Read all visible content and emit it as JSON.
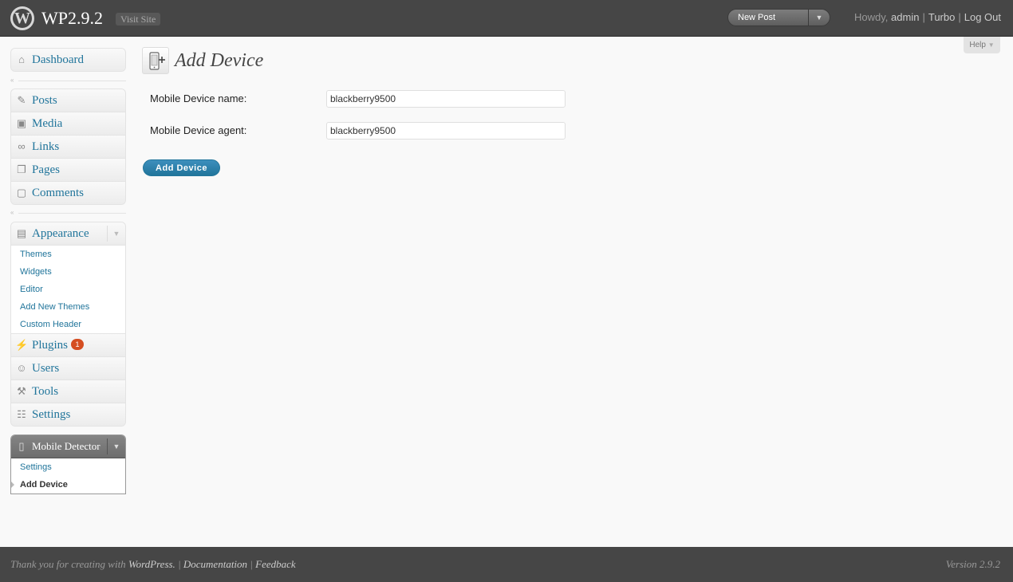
{
  "header": {
    "site_title": "WP2.9.2",
    "visit_site": "Visit Site",
    "favorite_action": "New Post",
    "howdy": "Howdy,",
    "user_name": "admin",
    "turbo": "Turbo",
    "log_out": "Log Out",
    "separator": "|"
  },
  "help": {
    "label": "Help"
  },
  "menu": {
    "dashboard": "Dashboard",
    "posts": "Posts",
    "media": "Media",
    "links": "Links",
    "pages": "Pages",
    "comments": "Comments",
    "appearance": "Appearance",
    "appearance_sub": [
      "Themes",
      "Widgets",
      "Editor",
      "Add New Themes",
      "Custom Header"
    ],
    "plugins": "Plugins",
    "plugins_badge": "1",
    "users": "Users",
    "tools": "Tools",
    "settings": "Settings",
    "mobile_detector": "Mobile Detector",
    "mobile_sub": [
      "Settings",
      "Add Device"
    ]
  },
  "page": {
    "title": "Add Device",
    "device_name_label": "Mobile Device name:",
    "device_name_value": "blackberry9500",
    "device_agent_label": "Mobile Device agent:",
    "device_agent_value": "blackberry9500",
    "submit_label": "Add Device"
  },
  "footer": {
    "thank_you": "Thank you for creating with",
    "wordpress": "WordPress.",
    "documentation": "Documentation",
    "feedback": "Feedback",
    "separator": "|",
    "version": "Version 2.9.2"
  },
  "colors": {
    "header_bg": "#464646",
    "link": "#21759b",
    "button": "#21759b",
    "badge": "#d54e21"
  },
  "icons": {
    "logo": "wordpress-logo-icon",
    "dashboard": "house-icon",
    "posts": "pushpin-icon",
    "media": "camera-icon",
    "links": "chain-link-icon",
    "pages": "pages-icon",
    "comments": "speech-bubble-icon",
    "appearance": "layout-icon",
    "plugins": "plug-icon",
    "users": "users-icon",
    "tools": "tools-icon",
    "settings": "settings-sliders-icon",
    "mobile_detector": "mobile-phone-icon",
    "page": "mobile-device-add-icon"
  }
}
